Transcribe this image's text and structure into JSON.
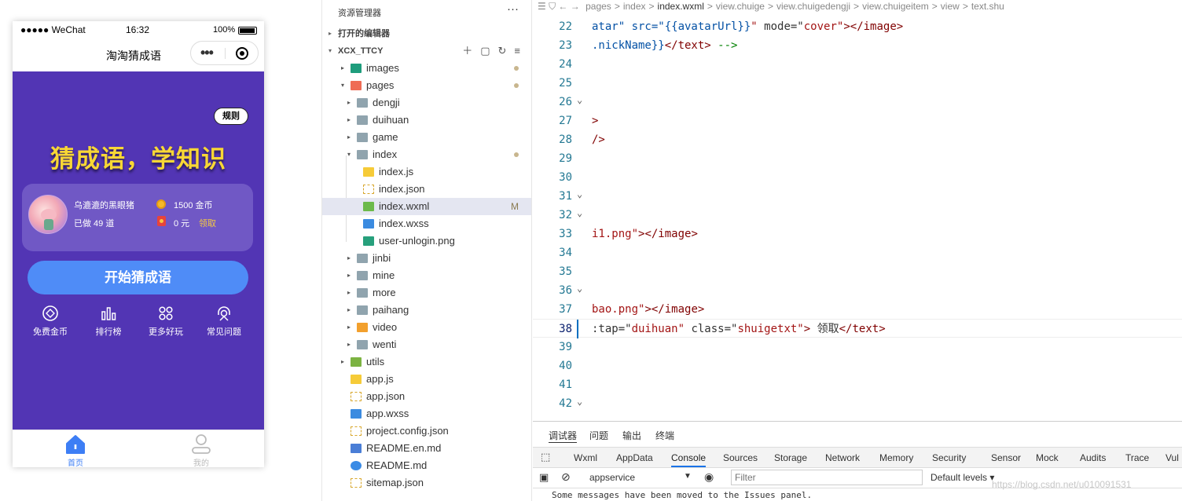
{
  "simulator": {
    "status": {
      "signal": "●●●●● WeChat",
      "time": "16:32",
      "battery": "100%"
    },
    "nav_title": "淘淘猜成语",
    "capsule_dots": "•••",
    "rules_label": "规则",
    "slogan": "猜成语，学知识",
    "user": {
      "name": "乌漉漉的黑眼猪",
      "done": "已做 49 道",
      "coins": "1500 金币",
      "money": "0 元",
      "claim": "领取"
    },
    "start_button": "开始猜成语",
    "menu": [
      {
        "label": "免费金币",
        "icon": "coin-circle-icon"
      },
      {
        "label": "排行榜",
        "icon": "bar-chart-icon"
      },
      {
        "label": "更多好玩",
        "icon": "grid-icon"
      },
      {
        "label": "常见问题",
        "icon": "headset-icon"
      }
    ],
    "tabs": [
      {
        "label": "首页",
        "icon": "home-icon",
        "active": true
      },
      {
        "label": "我的",
        "icon": "user-icon",
        "active": false
      }
    ],
    "colors": {
      "background": "#5235b4",
      "slogan": "#f8d735",
      "button": "#4f8cf7"
    }
  },
  "explorer": {
    "title": "资源管理器",
    "more": "···",
    "open_editors": "打开的编辑器",
    "project": "XCX_TTCY",
    "tree": [
      {
        "label": "images",
        "depth": 0,
        "kind": "folder-img",
        "arrow": "▸",
        "dot": true
      },
      {
        "label": "pages",
        "depth": 0,
        "kind": "folder-red",
        "arrow": "▾",
        "dot": true
      },
      {
        "label": "dengji",
        "depth": 1,
        "kind": "folder",
        "arrow": "▸"
      },
      {
        "label": "duihuan",
        "depth": 1,
        "kind": "folder",
        "arrow": "▸"
      },
      {
        "label": "game",
        "depth": 1,
        "kind": "folder",
        "arrow": "▸"
      },
      {
        "label": "index",
        "depth": 1,
        "kind": "folder-open",
        "arrow": "▾",
        "dot": true
      },
      {
        "label": "index.js",
        "depth": 2,
        "kind": "js"
      },
      {
        "label": "index.json",
        "depth": 2,
        "kind": "json"
      },
      {
        "label": "index.wxml",
        "depth": 2,
        "kind": "wxml",
        "badge": "M",
        "selected": true
      },
      {
        "label": "index.wxss",
        "depth": 2,
        "kind": "wxss"
      },
      {
        "label": "user-unlogin.png",
        "depth": 2,
        "kind": "png"
      },
      {
        "label": "jinbi",
        "depth": 1,
        "kind": "folder",
        "arrow": "▸"
      },
      {
        "label": "mine",
        "depth": 1,
        "kind": "folder",
        "arrow": "▸"
      },
      {
        "label": "more",
        "depth": 1,
        "kind": "folder",
        "arrow": "▸"
      },
      {
        "label": "paihang",
        "depth": 1,
        "kind": "folder",
        "arrow": "▸"
      },
      {
        "label": "video",
        "depth": 1,
        "kind": "folder-video",
        "arrow": "▸"
      },
      {
        "label": "wenti",
        "depth": 1,
        "kind": "folder",
        "arrow": "▸"
      },
      {
        "label": "utils",
        "depth": 0,
        "kind": "folder-utils",
        "arrow": "▸"
      },
      {
        "label": "app.js",
        "depth": 0,
        "kind": "js"
      },
      {
        "label": "app.json",
        "depth": 0,
        "kind": "json"
      },
      {
        "label": "app.wxss",
        "depth": 0,
        "kind": "wxss"
      },
      {
        "label": "project.config.json",
        "depth": 0,
        "kind": "json"
      },
      {
        "label": "README.en.md",
        "depth": 0,
        "kind": "md"
      },
      {
        "label": "README.md",
        "depth": 0,
        "kind": "info"
      },
      {
        "label": "sitemap.json",
        "depth": 0,
        "kind": "json"
      }
    ]
  },
  "editor": {
    "breadcrumb": [
      "pages",
      ">",
      "index",
      ">",
      "index.wxml",
      ">",
      "view.chuige",
      ">",
      "view.chuigedengji",
      ">",
      "view.chuigeitem",
      ">",
      "view",
      ">",
      "text.shu"
    ],
    "lines": [
      {
        "n": "22",
        "segs": [
          [
            "tmpl",
            "atar\" src=\""
          ],
          [
            "tmpl",
            "{{avatarUrl}}"
          ],
          [
            "str",
            "\""
          ],
          [
            "txt",
            " mode=\""
          ],
          [
            "str",
            "cover\""
          ],
          [
            "pun",
            ">"
          ],
          [
            "tag",
            "</image>"
          ]
        ]
      },
      {
        "n": "23",
        "segs": [
          [
            "tmpl",
            ".nickName}}"
          ],
          [
            "tag",
            "</text>"
          ],
          [
            "cm",
            " -->"
          ]
        ]
      },
      {
        "n": "24",
        "segs": []
      },
      {
        "n": "25",
        "segs": []
      },
      {
        "n": "26",
        "fold": true,
        "segs": []
      },
      {
        "n": "27",
        "segs": [
          [
            "pun",
            ">"
          ]
        ]
      },
      {
        "n": "28",
        "segs": [
          [
            "pun",
            "/>"
          ]
        ]
      },
      {
        "n": "29",
        "segs": []
      },
      {
        "n": "30",
        "segs": []
      },
      {
        "n": "31",
        "fold": true,
        "segs": []
      },
      {
        "n": "32",
        "fold": true,
        "segs": []
      },
      {
        "n": "33",
        "segs": [
          [
            "str",
            "i1.png\""
          ],
          [
            "pun",
            ">"
          ],
          [
            "tag",
            "</image>"
          ]
        ]
      },
      {
        "n": "34",
        "segs": []
      },
      {
        "n": "35",
        "segs": []
      },
      {
        "n": "36",
        "fold": true,
        "segs": []
      },
      {
        "n": "37",
        "segs": [
          [
            "str",
            "bao.png\""
          ],
          [
            "pun",
            ">"
          ],
          [
            "tag",
            "</image>"
          ]
        ]
      },
      {
        "n": "38",
        "current": true,
        "segs": [
          [
            "txt",
            ":tap=\""
          ],
          [
            "str",
            "duihuan\""
          ],
          [
            "txt",
            " class=\""
          ],
          [
            "str",
            "shuigetxt\""
          ],
          [
            "pun",
            ">"
          ],
          [
            "txt",
            " 领取"
          ],
          [
            "tag",
            "</text>"
          ]
        ]
      },
      {
        "n": "39",
        "segs": []
      },
      {
        "n": "40",
        "segs": []
      },
      {
        "n": "41",
        "segs": []
      },
      {
        "n": "42",
        "fold": true,
        "segs": []
      }
    ]
  },
  "devtools": {
    "panel_tabs": [
      "调试器",
      "问题",
      "输出",
      "终端"
    ],
    "tool_tabs": [
      "Wxml",
      "AppData",
      "Console",
      "Sources",
      "Storage",
      "Network",
      "Memory",
      "Security",
      "Sensor",
      "Mock",
      "Audits",
      "Trace",
      "Vul"
    ],
    "active_tool": "Console",
    "context": "appservice",
    "filter_placeholder": "Filter",
    "levels": "Default levels ▾",
    "message": "Some messages have been moved to the Issues panel."
  },
  "watermark": "https://blog.csdn.net/u010091531"
}
